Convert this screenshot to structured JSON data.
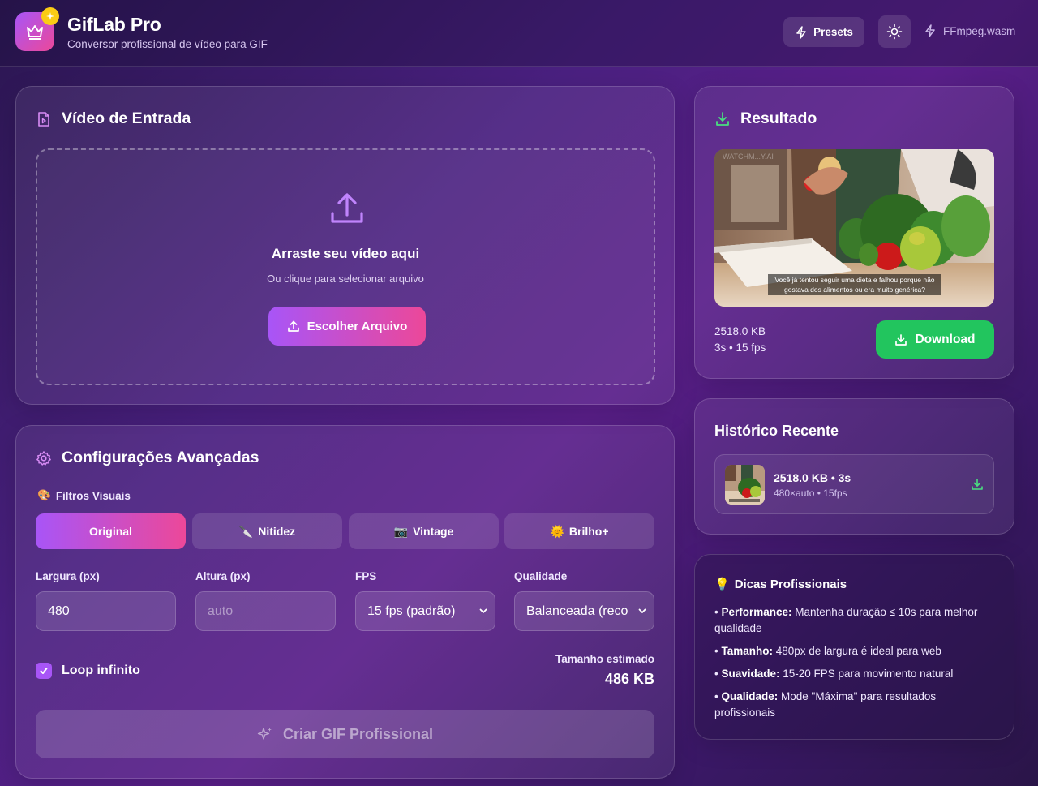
{
  "header": {
    "title": "GifLab Pro",
    "subtitle": "Conversor profissional de vídeo para GIF",
    "presets_label": "Presets",
    "engine_label": "FFmpeg.wasm"
  },
  "input_card": {
    "title": "Vídeo de Entrada",
    "drop_title": "Arraste seu vídeo aqui",
    "drop_subtitle": "Ou clique para selecionar arquivo",
    "choose_button": "Escolher Arquivo"
  },
  "settings_card": {
    "title": "Configurações Avançadas",
    "filters_label": "Filtros Visuais",
    "filters": [
      {
        "icon": "🎨",
        "label": "Original",
        "active": true
      },
      {
        "icon": "🔪",
        "label": "Nitidez",
        "active": false
      },
      {
        "icon": "📷",
        "label": "Vintage",
        "active": false
      },
      {
        "icon": "🌞",
        "label": "Brilho+",
        "active": false
      }
    ],
    "width_label": "Largura (px)",
    "width_value": "480",
    "height_label": "Altura (px)",
    "height_placeholder": "auto",
    "fps_label": "FPS",
    "fps_value": "15 fps (padrão)",
    "quality_label": "Qualidade",
    "quality_value": "Balanceada (reco",
    "loop_label": "Loop infinito",
    "loop_checked": true,
    "estimate_label": "Tamanho estimado",
    "estimate_value": "486 KB",
    "create_button": "Criar GIF Profissional"
  },
  "result_card": {
    "title": "Resultado",
    "caption_line1": "Você já tentou seguir uma dieta e falhou porque não",
    "caption_line2": "gostava dos alimentos ou era muito genérica?",
    "watermark": "WATCHM...Y.AI",
    "size": "2518.0 KB",
    "info": "3s • 15 fps",
    "download_button": "Download"
  },
  "history_card": {
    "title": "Histórico Recente",
    "items": [
      {
        "title": "2518.0 KB • 3s",
        "subtitle": "480×auto • 15fps"
      }
    ]
  },
  "tips_card": {
    "icon": "💡",
    "title": "Dicas Profissionais",
    "tips": [
      {
        "label": "Performance:",
        "text": " Mantenha duração ≤ 10s para melhor qualidade"
      },
      {
        "label": "Tamanho:",
        "text": " 480px de largura é ideal para web"
      },
      {
        "label": "Suavidade:",
        "text": " 15-20 FPS para movimento natural"
      },
      {
        "label": "Qualidade:",
        "text": " Mode \"Máxima\" para resultados profissionais"
      }
    ]
  },
  "colors": {
    "accent_start": "#a855f7",
    "accent_end": "#ec4899",
    "success": "#22c55e",
    "badge": "#facc15"
  }
}
